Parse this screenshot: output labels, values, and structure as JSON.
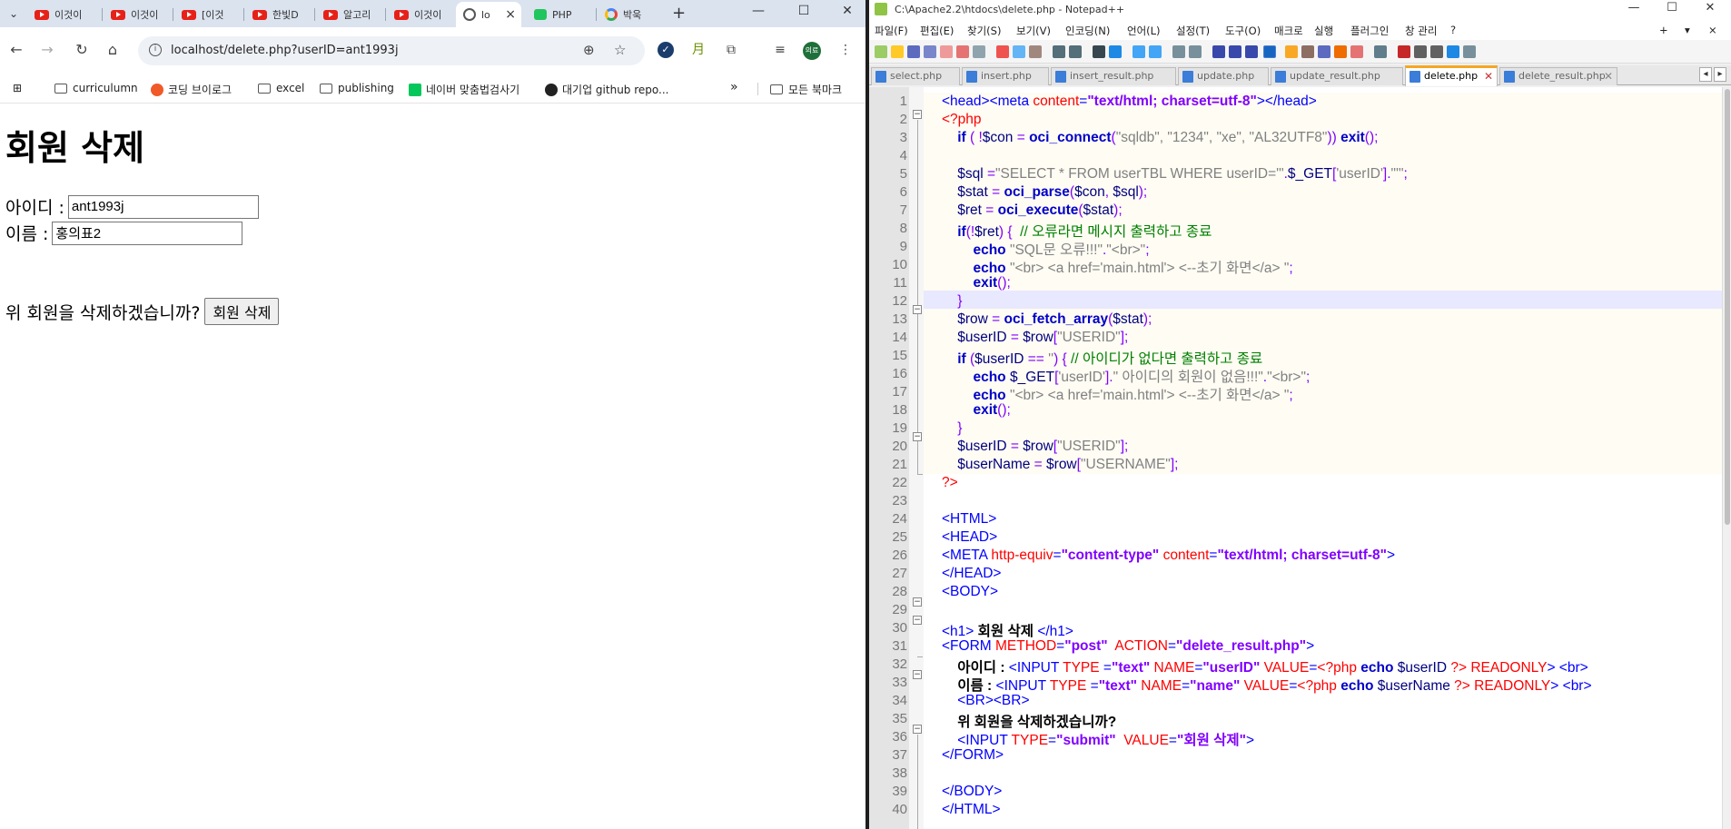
{
  "browser": {
    "tabs": [
      {
        "label": "이것이",
        "icon": "youtube-icon"
      },
      {
        "label": "이것이",
        "icon": "youtube-icon"
      },
      {
        "label": "[이것",
        "icon": "youtube-icon"
      },
      {
        "label": "한빛D",
        "icon": "youtube-icon"
      },
      {
        "label": "알고리",
        "icon": "youtube-icon"
      },
      {
        "label": "이것이",
        "icon": "youtube-icon"
      },
      {
        "label": "lo",
        "icon": "globe-icon"
      },
      {
        "label": "PHP",
        "icon": "naver-blog-icon"
      },
      {
        "label": "박욱",
        "icon": "google-icon"
      }
    ],
    "url": "localhost/delete.php?userID=ant1993j",
    "avatar_text": "의료",
    "bookmarks": [
      {
        "label": "curriculumn",
        "type": "folder"
      },
      {
        "label": "코딩 브이로그",
        "type": "site"
      },
      {
        "label": "excel",
        "type": "folder"
      },
      {
        "label": "publishing",
        "type": "folder"
      },
      {
        "label": "네이버 맞춤법검사기",
        "type": "naver"
      },
      {
        "label": "대기업 github repo...",
        "type": "github"
      }
    ],
    "bookmarks_more": "»",
    "all_bookmarks": "모든 북마크"
  },
  "page": {
    "heading": "회원 삭제",
    "id_label": "아이디 :",
    "id_value": "ant1993j",
    "name_label": "이름 :",
    "name_value": "홍의표2",
    "confirm_text": "위 회원을 삭제하겠습니까?",
    "submit_label": "회원 삭제"
  },
  "npp": {
    "title": "C:\\Apache2.2\\htdocs\\delete.php - Notepad++",
    "menu": [
      "파일(F)",
      "편집(E)",
      "찾기(S)",
      "보기(V)",
      "인코딩(N)",
      "언어(L)",
      "설정(T)",
      "도구(O)",
      "매크로",
      "실행",
      "플러그인",
      "창 관리",
      "?"
    ],
    "menu_right": [
      "+",
      "▾",
      "×"
    ],
    "tabs": [
      "select.php",
      "insert.php",
      "insert_result.php",
      "update.php",
      "update_result.php",
      "delete.php",
      "delete_result.php"
    ],
    "active_tab": "delete.php"
  }
}
